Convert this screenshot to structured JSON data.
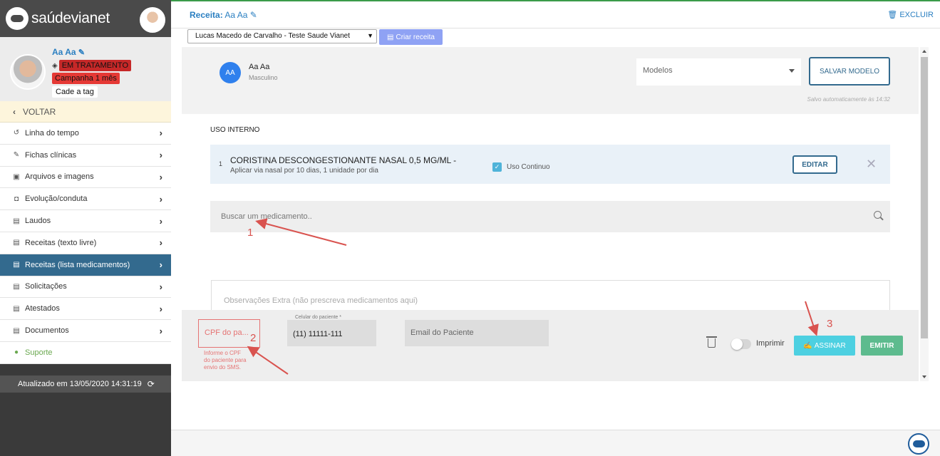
{
  "brand": {
    "name": "saúdevianet"
  },
  "patient": {
    "name": "Aa Aa",
    "tags": [
      "EM TRATAMENTO",
      "Campanha 1 mês"
    ],
    "add_tag": "Cade a tag"
  },
  "sidebar": {
    "back_label": "VOLTAR",
    "items": [
      {
        "label": "Linha do tempo",
        "icon": "history-icon"
      },
      {
        "label": "Fichas clínicas",
        "icon": "edit-icon"
      },
      {
        "label": "Arquivos e imagens",
        "icon": "file-image-icon"
      },
      {
        "label": "Evolução/conduta",
        "icon": "briefcase-icon"
      },
      {
        "label": "Laudos",
        "icon": "document-icon"
      },
      {
        "label": "Receitas (texto livre)",
        "icon": "document-icon"
      },
      {
        "label": "Receitas (lista medicamentos)",
        "icon": "document-icon"
      },
      {
        "label": "Solicitações",
        "icon": "document-icon"
      },
      {
        "label": "Atestados",
        "icon": "document-icon"
      },
      {
        "label": "Documentos",
        "icon": "document-icon"
      },
      {
        "label": "Suporte",
        "icon": "chat-icon"
      }
    ],
    "updated_text": "Atualizado em 13/05/2020 14:31:19"
  },
  "header": {
    "title_prefix": "Receita:",
    "title_value": "Aa Aa",
    "delete_label": "EXCLUIR"
  },
  "toolbar": {
    "doctor_selected": "Lucas Macedo de Carvalho - Teste Saude Vianet",
    "create_label": "Criar receita"
  },
  "prescription": {
    "patient_initials": "AA",
    "patient_name": "Aa Aa",
    "patient_sex": "Masculino",
    "models_placeholder": "Modelos",
    "save_model_label": "SALVAR MODELO",
    "autosave_text": "Salvo automaticamente às 14:32",
    "section_label": "USO INTERNO",
    "medication": {
      "number": "1",
      "name": "CORISTINA DESCONGESTIONANTE NASAL 0,5 MG/ML -",
      "dosage": "Aplicar via nasal por 10 dias, 1 unidade por dia",
      "continuous_label": "Uso Continuo",
      "continuous_checked": true,
      "edit_label": "EDITAR"
    },
    "search_placeholder": "Buscar um medicamento..",
    "obs_placeholder": "Observações Extra (não prescreva medicamentos aqui)"
  },
  "footer": {
    "cpf_placeholder": "CPF do pa...",
    "cpf_help": "Informe o CPF do paciente para envio do SMS.",
    "phone_label": "Celular do paciente *",
    "phone_value": "(11) 11111-111",
    "email_placeholder": "Email do Paciente",
    "print_label": "Imprimir",
    "print_enabled": false,
    "sign_label": "ASSINAR",
    "emit_label": "EMITIR"
  },
  "annotations": [
    "1",
    "2",
    "3"
  ],
  "colors": {
    "accent_blue": "#2a7fc1",
    "sidebar_active": "#336a8e",
    "tag_red": "#e53935",
    "sign_cyan": "#4dd0e1",
    "emit_green": "#5dbb8e",
    "annotation_red": "#d9534f"
  }
}
